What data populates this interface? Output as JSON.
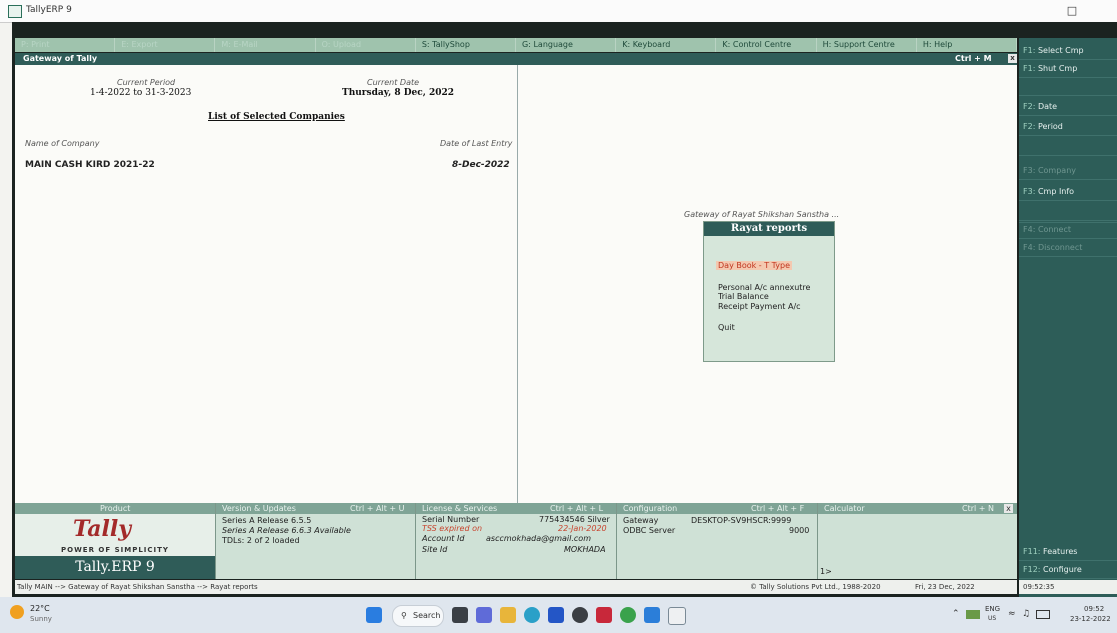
{
  "window": {
    "title": "TallyERP 9",
    "maximize_glyph": "□"
  },
  "menubar": {
    "items": [
      {
        "label": "P: Print",
        "dim": true
      },
      {
        "label": "E: Export",
        "dim": true
      },
      {
        "label": "M: E-Mail",
        "dim": true
      },
      {
        "label": "O: Upload",
        "dim": true
      },
      {
        "label": "S: TallyShop",
        "dim": false
      },
      {
        "label": "G: Language",
        "dim": false
      },
      {
        "label": "K: Keyboard",
        "dim": false
      },
      {
        "label": "K: Control Centre",
        "dim": false
      },
      {
        "label": "H: Support Centre",
        "dim": false
      },
      {
        "label": "H: Help",
        "dim": false
      }
    ]
  },
  "gateway": {
    "title": "Gateway of Tally",
    "shortcut": "Ctrl + M",
    "close": "x"
  },
  "left": {
    "current_period_label": "Current Period",
    "current_period_value": "1-4-2022 to 31-3-2023",
    "current_date_label": "Current Date",
    "current_date_value": "Thursday, 8 Dec, 2022",
    "list_title": "List of Selected Companies",
    "name_col_label": "Name of Company",
    "date_col_label": "Date of Last Entry",
    "company_name": "MAIN CASH KIRD 2021-22",
    "company_date": "8-Dec-2022"
  },
  "popup": {
    "breadcrumb": "Gateway of Rayat Shikshan Sanstha ...",
    "title": "Rayat reports",
    "items": [
      "Day Book - T Type",
      "Personal A/c annexutre",
      "Trial Balance",
      "Receipt Payment A/c",
      "Quit"
    ]
  },
  "right_buttons": [
    {
      "key": "F1:",
      "label": "Select Cmp",
      "dim": false
    },
    {
      "key": "F1:",
      "label": "Shut Cmp",
      "dim": false
    },
    {
      "key": "",
      "label": "",
      "dim": true
    },
    {
      "key": "F2:",
      "label": "Date",
      "dim": false
    },
    {
      "key": "F2:",
      "label": "Period",
      "dim": false
    },
    {
      "key": "",
      "label": "",
      "dim": true
    },
    {
      "key": "F3:",
      "label": "Company",
      "dim": true
    },
    {
      "key": "F3:",
      "label": "Cmp Info",
      "dim": false
    },
    {
      "key": "",
      "label": "",
      "dim": true
    },
    {
      "key": "",
      "label": "",
      "dim": true
    },
    {
      "key": "F4:",
      "label": "Connect",
      "dim": true
    },
    {
      "key": "F4:",
      "label": "Disconnect",
      "dim": true
    },
    {
      "key": "F11:",
      "label": "Features",
      "dim": false
    },
    {
      "key": "F12:",
      "label": "Configure",
      "dim": false
    }
  ],
  "bottom": {
    "product": {
      "header": "Product",
      "logo": "Tally",
      "tagline": "POWER OF SIMPLICITY",
      "edition": "Tally.ERP 9"
    },
    "version": {
      "header": "Version & Updates",
      "shortcut": "Ctrl + Alt + U",
      "line1": "Series A Release 6.5.5",
      "line2": "Series A Release 6.6.3 Available",
      "line3": "TDLs: 2 of 2 loaded"
    },
    "license": {
      "header": "License & Services",
      "shortcut": "Ctrl + Alt + L",
      "serial_label": "Serial Number",
      "serial_value": "775434546 Silver",
      "tss_label": "TSS expired on",
      "tss_value": "22-Jan-2020",
      "account_label": "Account Id",
      "account_value": "asccmokhada@gmail.com",
      "site_label": "Site Id",
      "site_value": "MOKHADA"
    },
    "config": {
      "header": "Configuration",
      "shortcut": "Ctrl + Alt + F",
      "gateway_label": "Gateway",
      "gateway_value": "DESKTOP-SV9HSCR:9999",
      "odbc_label": "ODBC Server",
      "odbc_value": "9000"
    },
    "calc": {
      "header": "Calculator",
      "shortcut": "Ctrl + N",
      "close": "x",
      "prompt": "1>"
    }
  },
  "statusbar": {
    "breadcrumb": "Tally MAIN --> Gateway of Rayat Shikshan Sanstha --> Rayat reports",
    "copyright": "© Tally Solutions Pvt Ltd., 1988-2020",
    "date": "Fri, 23 Dec, 2022",
    "time": "09:52:35"
  },
  "taskbar": {
    "weather_temp": "22°C",
    "weather_desc": "Sunny",
    "search": "Search",
    "lang": "ENG",
    "lang_sub": "US",
    "clock_time": "09:52",
    "clock_date": "23-12-2022"
  }
}
